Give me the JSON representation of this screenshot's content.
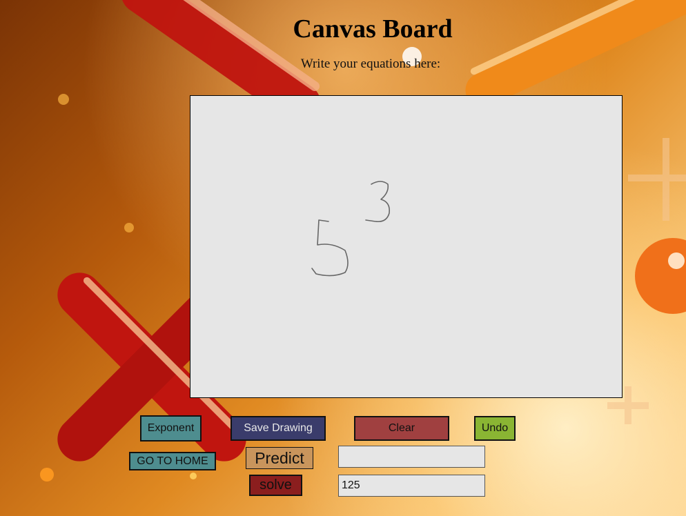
{
  "header": {
    "title": "Canvas Board",
    "subtitle": "Write your equations here:"
  },
  "canvas": {
    "drawn_content": "5 3"
  },
  "toolbar": {
    "exponent_label": "Exponent",
    "save_label": "Save Drawing",
    "clear_label": "Clear",
    "undo_label": "Undo",
    "home_label": "GO TO HOME",
    "predict_label": "Predict",
    "solve_label": "solve"
  },
  "fields": {
    "predict_value": "",
    "solve_value": "125"
  },
  "colors": {
    "canvas_bg": "#e6e6e6",
    "exponent_btn": "#4e8d8f",
    "save_btn": "#3a3c6b",
    "clear_btn": "#a04040",
    "undo_btn": "#8ab533",
    "predict_btn": "#c9955c",
    "solve_btn": "#8b1e1e"
  }
}
